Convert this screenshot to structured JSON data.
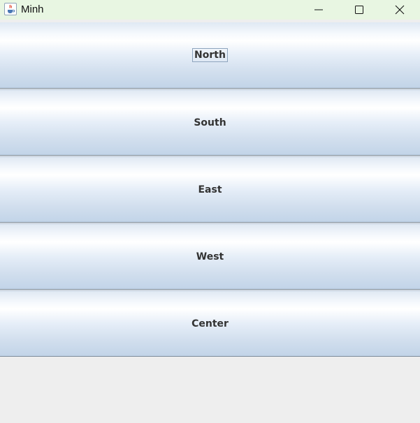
{
  "window": {
    "title": "Minh",
    "icon": "java-cup-icon",
    "controls": [
      "minimize",
      "maximize",
      "close"
    ]
  },
  "buttons": [
    {
      "label": "North",
      "focused": true
    },
    {
      "label": "South"
    },
    {
      "label": "East"
    },
    {
      "label": "West"
    },
    {
      "label": "Center"
    }
  ]
}
